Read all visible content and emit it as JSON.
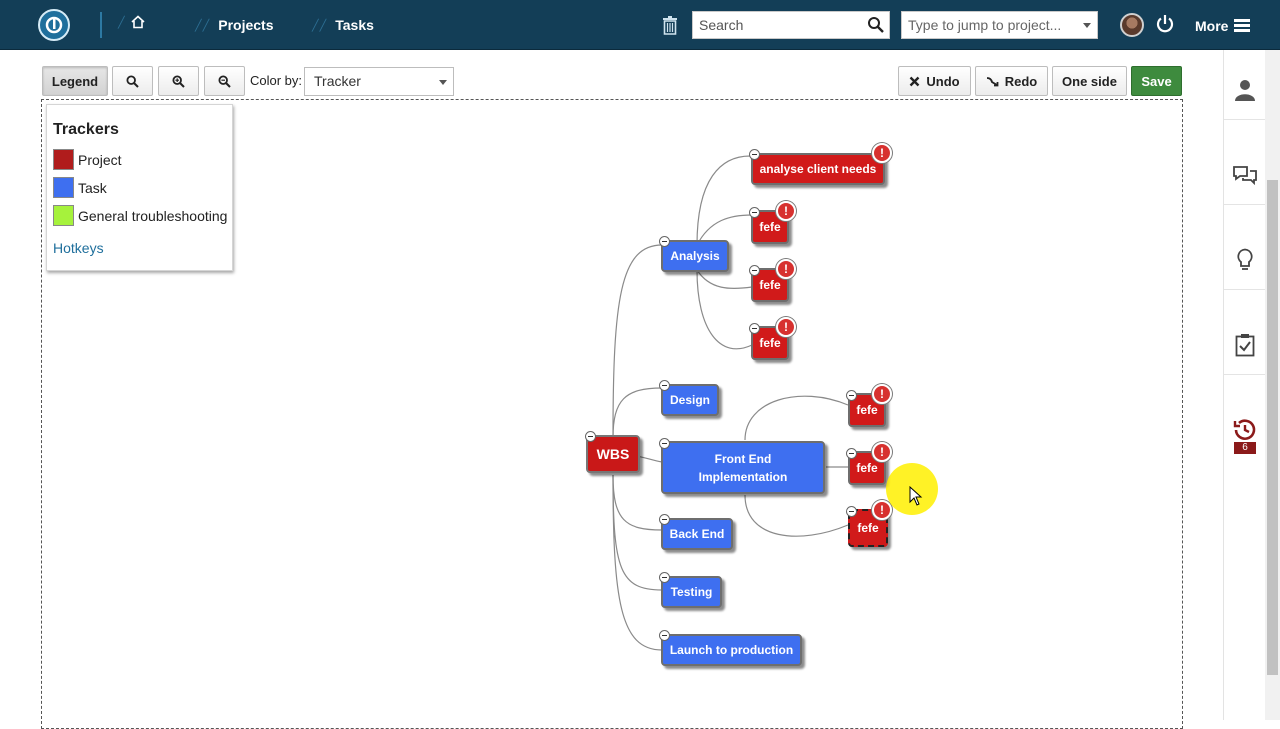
{
  "nav": {
    "projects_label": "Projects",
    "tasks_label": "Tasks",
    "search_placeholder": "Search",
    "jump_placeholder": "Type to jump to project...",
    "more_label": "More"
  },
  "toolbar": {
    "legend_label": "Legend",
    "color_by_label": "Color by:",
    "color_by_value": "Tracker",
    "undo_label": "Undo",
    "redo_label": "Redo",
    "one_side_label": "One side",
    "save_label": "Save"
  },
  "legend": {
    "title": "Trackers",
    "items": [
      {
        "label": "Project",
        "color": "#b01c1c"
      },
      {
        "label": "Task",
        "color": "#3e6ff0"
      },
      {
        "label": "General troubleshooting",
        "color": "#a6f23c"
      }
    ],
    "hotkeys_label": "Hotkeys"
  },
  "mindmap": {
    "root": "WBS",
    "nodes": {
      "analysis": "Analysis",
      "analyse_client_needs": "analyse client needs",
      "fefe": "fefe",
      "design": "Design",
      "front_end": "Front End Implementation",
      "back_end": "Back End",
      "testing": "Testing",
      "launch": "Launch to production"
    }
  },
  "rail": {
    "badge_count": "6"
  },
  "colors": {
    "nav_bg": "#133e57",
    "task": "#3e6ff0",
    "project": "#d11a1a",
    "save": "#3e8b3e"
  }
}
